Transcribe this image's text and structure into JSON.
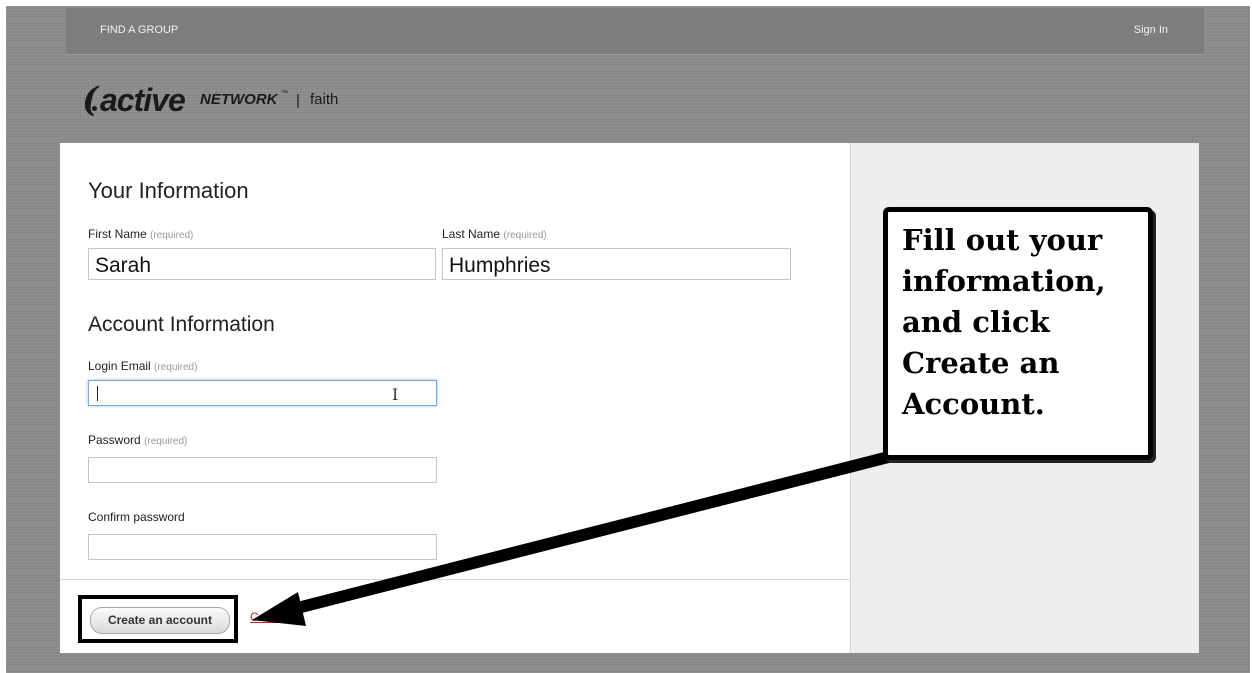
{
  "topnav": {
    "find_group": "FIND A GROUP",
    "sign_in": "Sign In"
  },
  "logo": {
    "active": "active",
    "network": "NETWORK",
    "tm": "™",
    "separator": "|",
    "product": "faith"
  },
  "form": {
    "your_info_title": "Your Information",
    "first_name_label": "First Name",
    "first_name_req": "(required)",
    "first_name_value": "Sarah",
    "last_name_label": "Last Name",
    "last_name_req": "(required)",
    "last_name_value": "Humphries",
    "account_info_title": "Account Information",
    "email_label": "Login Email",
    "email_req": "(required)",
    "email_value": "",
    "password_label": "Password",
    "password_req": "(required)",
    "password_value": "",
    "confirm_label": "Confirm password",
    "confirm_value": ""
  },
  "actions": {
    "create": "Create an account",
    "cancel": "Cancel"
  },
  "callout": {
    "text": "Fill out your information, and click Create an Account."
  },
  "colors": {
    "accent_red": "#cc2222",
    "focus_blue": "#7fa6d8"
  }
}
